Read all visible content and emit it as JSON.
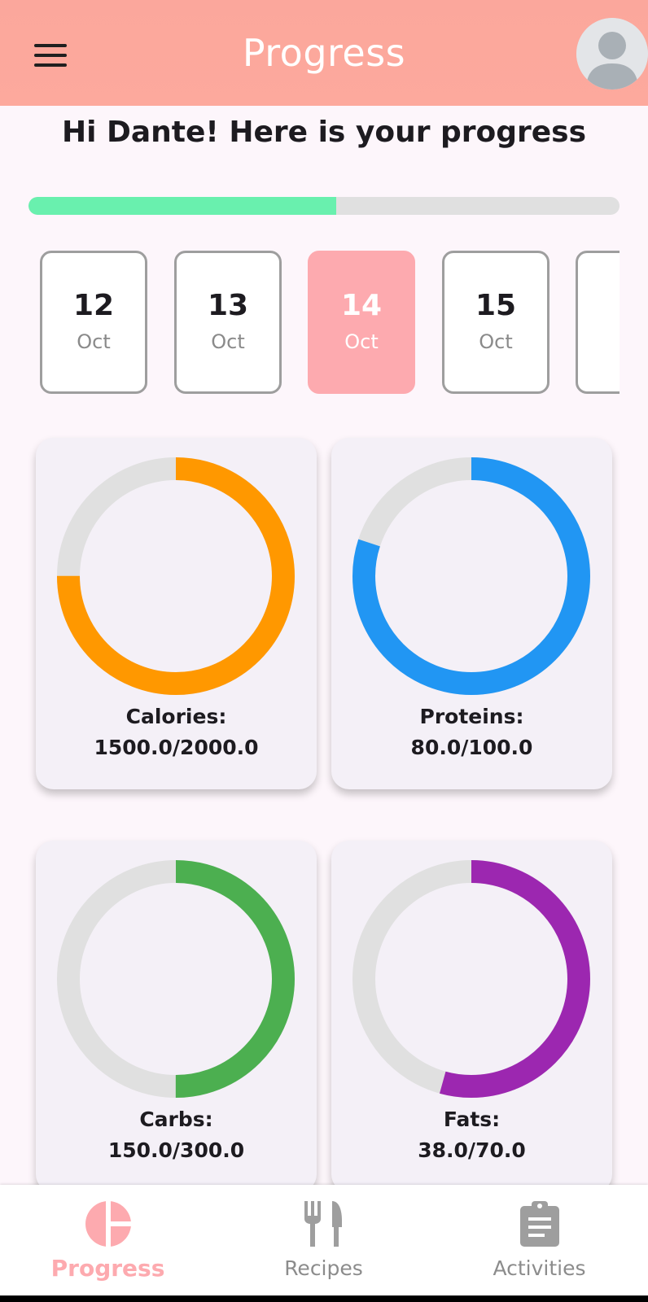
{
  "appbar": {
    "title": "Progress",
    "menu_icon": "hamburger-menu-icon",
    "avatar_icon": "person-avatar-icon"
  },
  "greeting": "Hi Dante! Here is your progress",
  "daily_progress": {
    "fraction": 0.52,
    "fill_color": "#69f0ae",
    "track_color": "#e0e0e0"
  },
  "dates": [
    {
      "day": "12",
      "month": "Oct",
      "selected": false
    },
    {
      "day": "13",
      "month": "Oct",
      "selected": false
    },
    {
      "day": "14",
      "month": "Oct",
      "selected": true
    },
    {
      "day": "15",
      "month": "Oct",
      "selected": false
    },
    {
      "day": "",
      "month": "",
      "selected": false
    }
  ],
  "nutrients": [
    {
      "label": "Calories:",
      "value": "1500.0/2000.0",
      "current": 1500.0,
      "goal": 2000.0,
      "color": "#ff9800"
    },
    {
      "label": "Proteins:",
      "value": "80.0/100.0",
      "current": 80.0,
      "goal": 100.0,
      "color": "#2196f3"
    },
    {
      "label": "Carbs:",
      "value": "150.0/300.0",
      "current": 150.0,
      "goal": 300.0,
      "color": "#4caf50"
    },
    {
      "label": "Fats:",
      "value": "38.0/70.0",
      "current": 38.0,
      "goal": 70.0,
      "color": "#9c27b0"
    }
  ],
  "bottom_nav": {
    "items": [
      {
        "label": "Progress",
        "icon": "pie-chart-icon",
        "active": true
      },
      {
        "label": "Recipes",
        "icon": "fork-knife-icon",
        "active": false
      },
      {
        "label": "Activities",
        "icon": "clipboard-icon",
        "active": false
      }
    ],
    "active_color": "#fdaaaf",
    "inactive_color": "#9e9e9e"
  }
}
